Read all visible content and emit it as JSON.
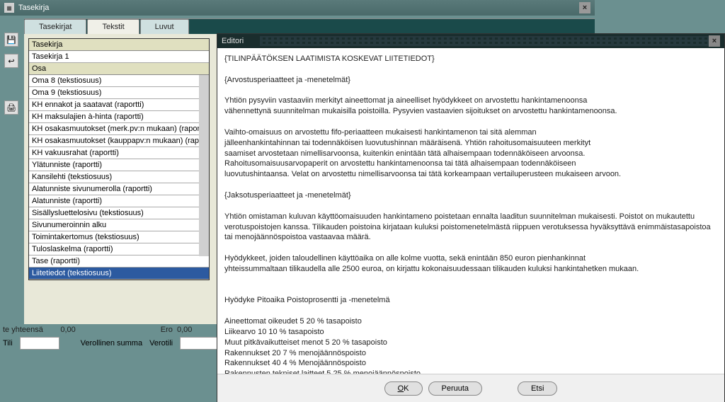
{
  "window": {
    "title": "Tasekirja"
  },
  "tabs": [
    {
      "label": "Tasekirjat"
    },
    {
      "label": "Tekstit"
    },
    {
      "label": "Luvut"
    }
  ],
  "tree": {
    "header1": "Tasekirja",
    "row1": "Tasekirja 1",
    "header2": "Osa",
    "items": [
      "Oma 8    (tekstiosuus)",
      "Oma 9    (tekstiosuus)",
      "KH ennakot ja saatavat    (raportti)",
      "KH maksulajien à-hinta    (raportti)",
      "KH osakasmuutokset (merk.pv:n mukaan)    (rapor",
      "KH osakasmuutokset (kauppapv:n mukaan)    (rap",
      "KH vakuusrahat    (raportti)",
      "Ylätunniste    (raportti)",
      "Kansilehti    (tekstiosuus)",
      "Alatunniste sivunumerolla    (raportti)",
      "Alatunniste    (raportti)",
      "Sisällysluettelosivu    (tekstiosuus)",
      "Sivunumeroinnin alku",
      "Toimintakertomus    (tekstiosuus)",
      "Tuloslaskelma    (raportti)",
      "Tase    (raportti)",
      "Liitetiedot    (tekstiosuus)"
    ]
  },
  "stats": {
    "label_yht": "te yhteensä",
    "val_yht": "0,00",
    "label_ero": "Ero",
    "val_ero": "0,00"
  },
  "fields": {
    "tili_label": "Tili",
    "verollinen_label": "Verollinen summa",
    "verotili_label": "Verotili"
  },
  "editor": {
    "title": "Editori",
    "body": "{TILINPÄÄTÖKSEN LAATIMISTA KOSKEVAT LIITETIEDOT}\n\n{Arvostusperiaatteet ja -menetelmät}\n\nYhtiön pysyviin vastaaviin merkityt aineettomat ja aineelliset hyödykkeet on arvostettu hankintamenoonsa\nvähennettynä suunnitelman mukaisilla poistoilla.  Pysyvien vastaavien sijoitukset on arvostettu hankintamenoonsa.\n\nVaihto-omaisuus on arvostettu fifo-periaatteen mukaisesti hankintamenon tai sitä alemman\njälleenhankintahinnan tai todennäköisen luovutushinnan määräisenä.  Yhtiön rahoitusomaisuuteen merkityt\nsaamiset arvostetaan nimellisarvoonsa, kuitenkin enintään tätä alhaisempaan todennäköiseen arvoonsa.\nRahoitusomaisuusarvopaperit on arvostettu hankintamenoonsa tai tätä alhaisempaan todennäköiseen\nluovutushintaansa.  Velat on arvostettu nimellisarvoonsa tai tätä korkeampaan vertailuperusteen mukaiseen arvoon.\n\n{Jaksotusperiaatteet ja -menetelmät}\n\nYhtiön omistaman kuluvan käyttöomaisuuden hankintameno poistetaan ennalta laaditun suunnitelman mukaisesti. Poistot on mukautettu verotuspoistojen kanssa. Tilikauden poistoina kirjataan kuluksi poistomenetelmästä riippuen verotuksessa hyväksyttävä enimmäistasapoistoa tai menojäännöspoistoa vastaavaa määrä.\n\nHyödykkeet, joiden taloudellinen käyttöaika on alle kolme vuotta, sekä enintään 850 euron pienhankinnat\nyhteissummaltaan tilikaudella alle 2500 euroa, on kirjattu kokonaisuudessaan tilikauden kuluksi hankintahetken mukaan.\n\n\nHyödyke  Pitoaika            Poistoprosentti ja -menetelmä\n\nAineettomat oikeudet          5                          20 % tasapoisto\nLiikearvo   10                     10 % tasapoisto\nMuut pitkävaikutteiset menot          5                          20 % tasapoisto\nRakennukset    20                       7 % menojäännöspoisto\nRakennukset    40                       4 % Menojäännöspoisto\nRakennusten tekniset laitteet        5                         25 % menojäännöspoisto",
    "buttons": {
      "ok": "OK",
      "cancel": "Peruuta",
      "find": "Etsi"
    }
  }
}
